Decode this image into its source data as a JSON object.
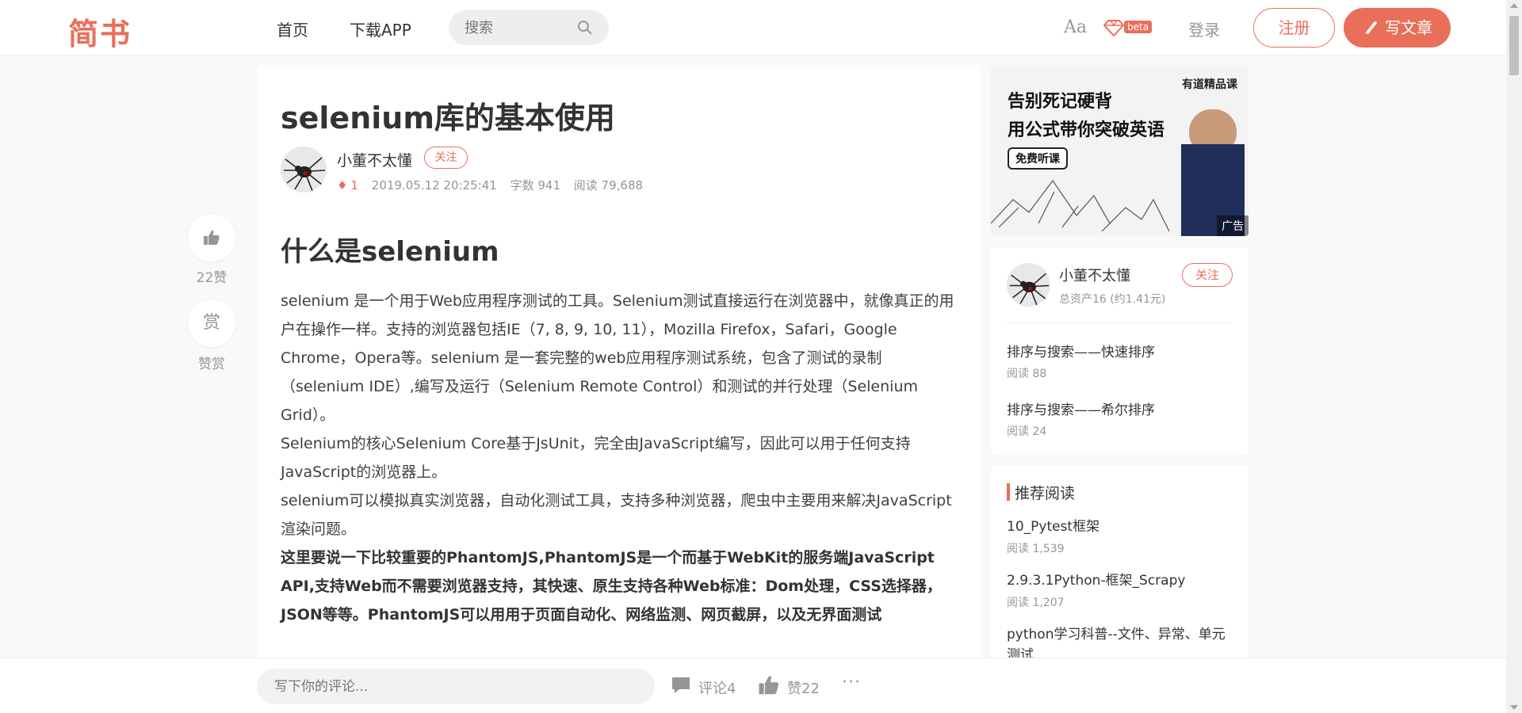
{
  "header": {
    "logo": "简书",
    "nav": {
      "home": "首页",
      "download_app": "下载APP"
    },
    "search": {
      "placeholder": "搜索"
    },
    "font_toggle": "Aa",
    "beta_badge": "beta",
    "login": "登录",
    "register": "注册",
    "write": "写文章"
  },
  "side_actions": {
    "like_label": "22赞",
    "reward_icon": "赏",
    "reward_label": "赞赏"
  },
  "article": {
    "title": "selenium库的基本使用",
    "author": "小董不太懂",
    "follow": "关注",
    "meta": {
      "diamond_count": "1",
      "date": "2019.05.12 20:25:41",
      "words": "字数 941",
      "reads": "阅读 79,688"
    },
    "section_title": "什么是selenium",
    "paragraphs": [
      "selenium 是一个用于Web应用程序测试的工具。Selenium测试直接运行在浏览器中，就像真正的用户在操作一样。支持的浏览器包括IE（7, 8, 9, 10, 11），Mozilla Firefox，Safari，Google Chrome，Opera等。selenium 是一套完整的web应用程序测试系统，包含了测试的录制（selenium IDE）,编写及运行（Selenium Remote Control）和测试的并行处理（Selenium Grid）。",
      "Selenium的核心Selenium Core基于JsUnit，完全由JavaScript编写，因此可以用于任何支持JavaScript的浏览器上。",
      "selenium可以模拟真实浏览器，自动化测试工具，支持多种浏览器，爬虫中主要用来解决JavaScript渲染问题。",
      "这里要说一下比较重要的PhantomJS,PhantomJS是一个而基于WebKit的服务端JavaScript API,支持Web而不需要浏览器支持，其快速、原生支持各种Web标准：Dom处理，CSS选择器，JSON等等。PhantomJS可以用用于页面自动化、网络监测、网页截屏，以及无界面测试"
    ]
  },
  "ad": {
    "line1": "告别死记硬背",
    "line2": "用公式带你突破英语",
    "brand": "有道精品课",
    "button": "免费听课",
    "badge": "广告"
  },
  "author_card": {
    "name": "小董不太懂",
    "assets": "总资产16 (约1.41元)",
    "follow": "关注",
    "posts": [
      {
        "title": "排序与搜索——快速排序",
        "reads": "阅读 88"
      },
      {
        "title": "排序与搜索——希尔排序",
        "reads": "阅读 24"
      }
    ]
  },
  "recommend": {
    "title": "推荐阅读",
    "items": [
      {
        "title": "10_Pytest框架",
        "reads": "阅读 1,539"
      },
      {
        "title": "2.9.3.1Python-框架_Scrapy",
        "reads": "阅读 1,207"
      },
      {
        "title": "python学习科普--文件、异常、单元测试",
        "reads": ""
      }
    ]
  },
  "bottom_bar": {
    "comment_placeholder": "写下你的评论...",
    "comment_label": "评论4",
    "like_label": "赞22",
    "more": "···"
  },
  "colors": {
    "accent": "#ea6f5a",
    "text": "#404040",
    "muted": "#969696",
    "background": "#f9f9f9"
  }
}
